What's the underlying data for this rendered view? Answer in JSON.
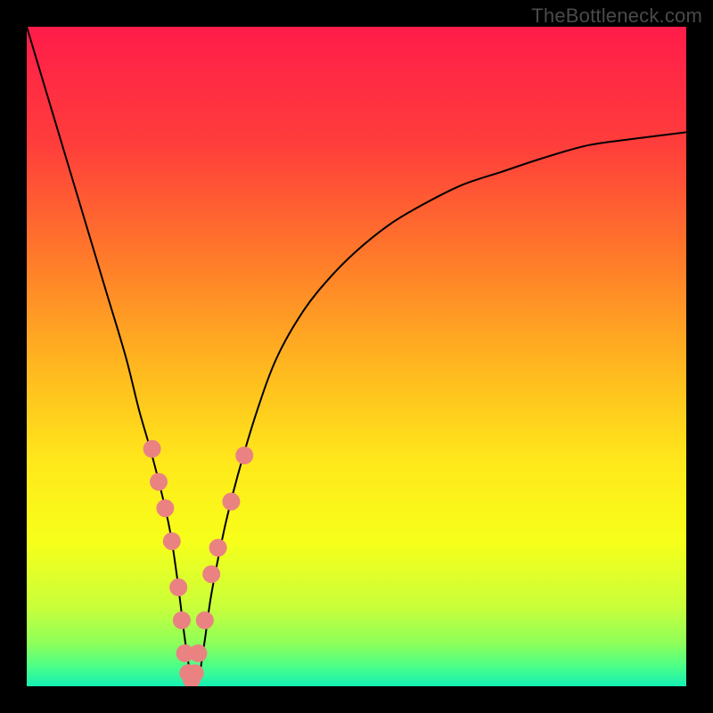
{
  "watermark": "TheBottleneck.com",
  "chart_data": {
    "type": "line",
    "title": "",
    "xlabel": "",
    "ylabel": "",
    "xlim": [
      0,
      100
    ],
    "ylim": [
      0,
      100
    ],
    "grid": false,
    "legend": false,
    "background_gradient": {
      "stops": [
        {
          "pos": 0.0,
          "color": "#ff1c4a"
        },
        {
          "pos": 0.18,
          "color": "#ff3e3b"
        },
        {
          "pos": 0.35,
          "color": "#ff7a2a"
        },
        {
          "pos": 0.52,
          "color": "#ffb91f"
        },
        {
          "pos": 0.66,
          "color": "#ffe81b"
        },
        {
          "pos": 0.78,
          "color": "#f7ff1a"
        },
        {
          "pos": 0.88,
          "color": "#c9ff3a"
        },
        {
          "pos": 0.935,
          "color": "#8eff5a"
        },
        {
          "pos": 0.97,
          "color": "#4bff88"
        },
        {
          "pos": 1.0,
          "color": "#14f0b4"
        }
      ]
    },
    "series": [
      {
        "name": "bottleneck-curve",
        "color": "#000000",
        "stroke_width": 2,
        "x": [
          0,
          3,
          6,
          9,
          12,
          15,
          17,
          19,
          21,
          22,
          23,
          24,
          25,
          26,
          27,
          28,
          30,
          32,
          35,
          38,
          42,
          46,
          50,
          55,
          60,
          66,
          72,
          78,
          85,
          92,
          100
        ],
        "values": [
          100,
          90,
          80,
          70,
          60,
          50,
          42,
          35,
          27,
          22,
          15,
          7,
          1,
          1,
          7,
          14,
          24,
          32,
          42,
          50,
          57,
          62,
          66,
          70,
          73,
          76,
          78,
          80,
          82,
          83,
          84
        ]
      },
      {
        "name": "highlight-dots",
        "color": "#ea8282",
        "marker_radius": 10,
        "x": [
          19,
          20,
          21,
          22,
          23,
          23.5,
          24,
          24.5,
          25,
          25.5,
          26,
          27,
          28,
          29,
          31,
          33
        ],
        "values": [
          36,
          31,
          27,
          22,
          15,
          10,
          5,
          2,
          1,
          2,
          5,
          10,
          17,
          21,
          28,
          35
        ]
      }
    ]
  }
}
